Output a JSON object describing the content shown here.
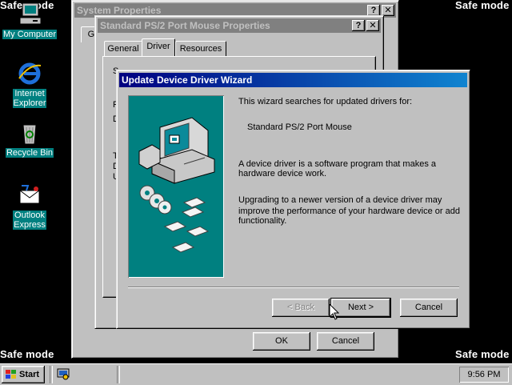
{
  "desktop": {
    "safe_mode": "Safe mode",
    "icons": [
      {
        "label": "My Computer"
      },
      {
        "label": "Internet Explorer"
      },
      {
        "label": "Recycle Bin"
      },
      {
        "label": "Outlook Express"
      }
    ]
  },
  "system_properties": {
    "title": "System Properties",
    "help_btn": "?",
    "close_btn": "✕",
    "tab_partial": "Ge",
    "ok": "OK",
    "cancel": "Cancel"
  },
  "mouse_properties": {
    "title": "Standard PS/2 Port Mouse Properties",
    "help_btn": "?",
    "close_btn": "✕",
    "tabs": [
      "General",
      "Driver",
      "Resources"
    ],
    "selected_tab": "Driver",
    "partial_letters": [
      "S",
      "P",
      "D",
      "T",
      "D",
      "U"
    ]
  },
  "wizard": {
    "title": "Update Device Driver Wizard",
    "intro": "This wizard searches for updated drivers for:",
    "device": "Standard PS/2 Port Mouse",
    "para1_line1": "A device driver is a software program that makes a",
    "para1_line2": "hardware device work.",
    "para2_line1": "Upgrading to a newer version of a device driver may",
    "para2_line2": "improve the performance of your hardware device or add",
    "para2_line3": "functionality.",
    "back": "< Back",
    "next": "Next >",
    "cancel": "Cancel"
  },
  "taskbar": {
    "start": "Start",
    "clock": "9:56 PM"
  },
  "colors": {
    "desktop": "#000000",
    "active_title": "#000080",
    "inactive_title": "#808080",
    "wizard_art_bg": "#008080"
  }
}
